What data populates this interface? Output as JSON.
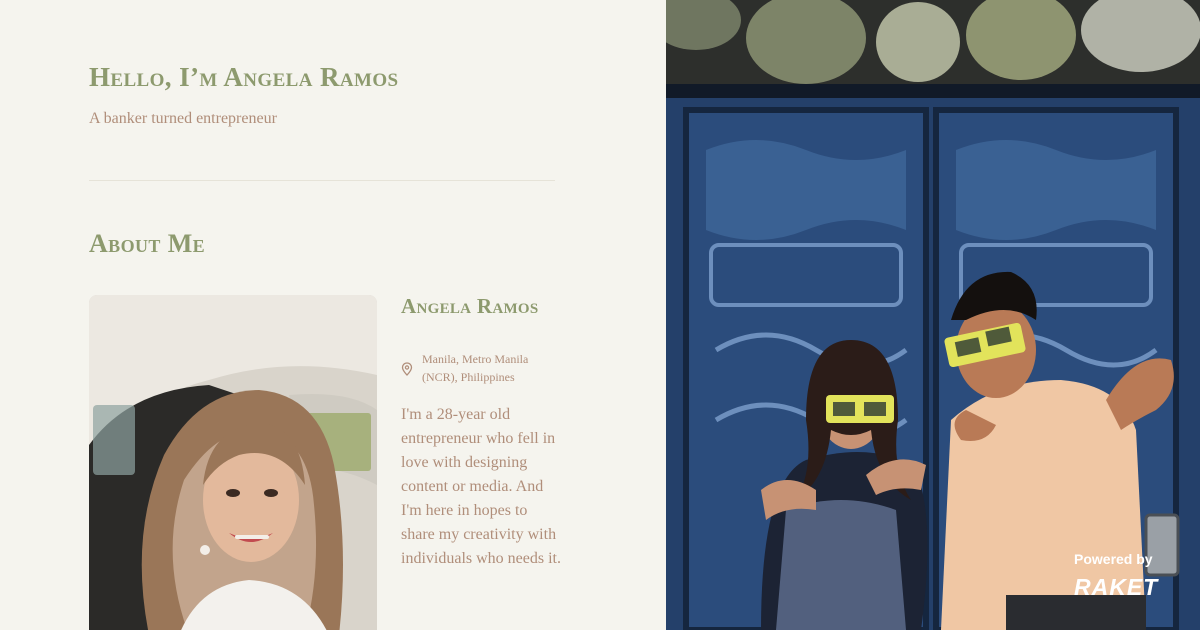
{
  "hero": {
    "title": "Hello, I’m Angela Ramos",
    "subtitle": "A banker turned entrepreneur"
  },
  "about": {
    "section_title": "About Me",
    "name": "Angela Ramos",
    "location": "Manila, Metro Manila (NCR), Philippines",
    "bio": "I'm a 28-year old entrepreneur who fell in love with designing content or media. And I'm here in hopes to share my creativity with individuals who needs it."
  },
  "branding": {
    "powered_by": "Powered by",
    "logo_text": "RAKET"
  },
  "icons": {
    "location": "location-pin-icon"
  },
  "colors": {
    "background": "#f5f4ee",
    "heading": "#8d9a6e",
    "body_text": "#b08e7a",
    "divider": "#e6e3d8"
  }
}
